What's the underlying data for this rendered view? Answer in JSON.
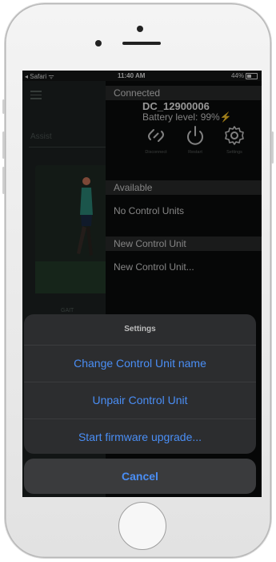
{
  "status_bar": {
    "carrier": "◂ Safari ᯤ",
    "time": "11:40 AM",
    "battery_percent": "44%",
    "battery_level": 0.44
  },
  "background_app": {
    "assist_label": "Assist",
    "gait_label": "GAIT"
  },
  "panel": {
    "connected_header": "Connected",
    "device_name": "DC_12900006",
    "battery_text": "Battery level: 99%",
    "bolt": "⚡",
    "actions": [
      {
        "label": "Disconnect",
        "icon": "disconnect-icon"
      },
      {
        "label": "Restart",
        "icon": "restart-icon"
      },
      {
        "label": "Settings",
        "icon": "gear-icon"
      }
    ],
    "available_header": "Available",
    "available_text": "No Control Units",
    "new_header": "New Control Unit",
    "new_text": "New Control Unit..."
  },
  "action_sheet": {
    "title": "Settings",
    "options": [
      "Change Control Unit name",
      "Unpair Control Unit",
      "Start firmware upgrade..."
    ],
    "cancel": "Cancel",
    "accent_color": "#4a8ef5"
  }
}
